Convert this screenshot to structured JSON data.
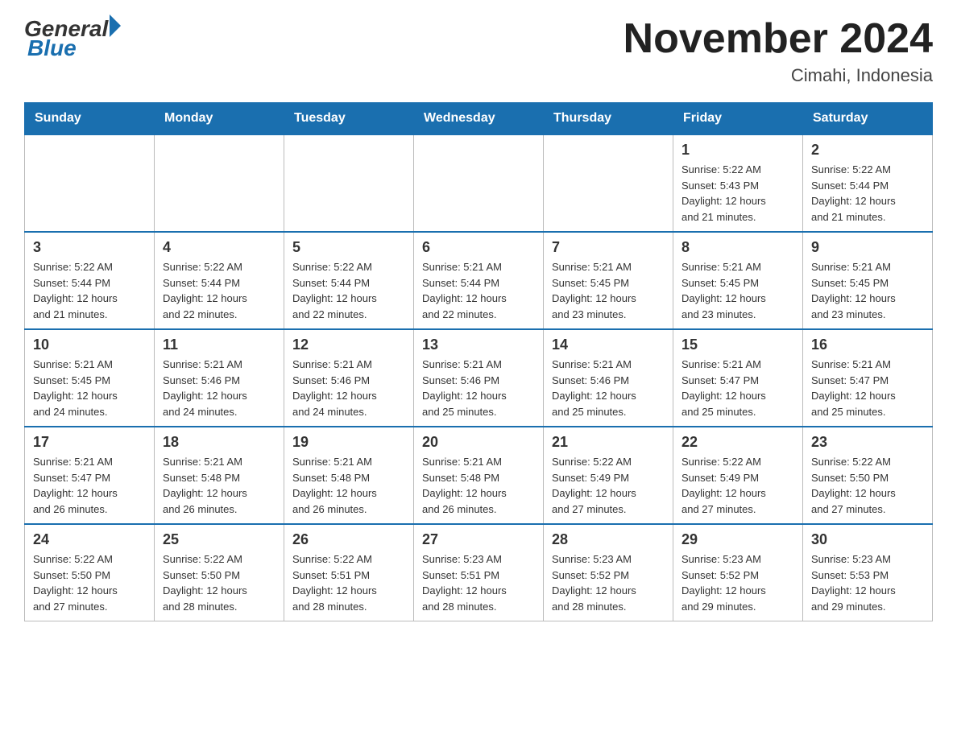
{
  "logo": {
    "text_general": "General",
    "text_blue": "Blue"
  },
  "header": {
    "month_year": "November 2024",
    "location": "Cimahi, Indonesia"
  },
  "weekdays": [
    "Sunday",
    "Monday",
    "Tuesday",
    "Wednesday",
    "Thursday",
    "Friday",
    "Saturday"
  ],
  "weeks": [
    [
      {
        "day": "",
        "info": ""
      },
      {
        "day": "",
        "info": ""
      },
      {
        "day": "",
        "info": ""
      },
      {
        "day": "",
        "info": ""
      },
      {
        "day": "",
        "info": ""
      },
      {
        "day": "1",
        "info": "Sunrise: 5:22 AM\nSunset: 5:43 PM\nDaylight: 12 hours\nand 21 minutes."
      },
      {
        "day": "2",
        "info": "Sunrise: 5:22 AM\nSunset: 5:44 PM\nDaylight: 12 hours\nand 21 minutes."
      }
    ],
    [
      {
        "day": "3",
        "info": "Sunrise: 5:22 AM\nSunset: 5:44 PM\nDaylight: 12 hours\nand 21 minutes."
      },
      {
        "day": "4",
        "info": "Sunrise: 5:22 AM\nSunset: 5:44 PM\nDaylight: 12 hours\nand 22 minutes."
      },
      {
        "day": "5",
        "info": "Sunrise: 5:22 AM\nSunset: 5:44 PM\nDaylight: 12 hours\nand 22 minutes."
      },
      {
        "day": "6",
        "info": "Sunrise: 5:21 AM\nSunset: 5:44 PM\nDaylight: 12 hours\nand 22 minutes."
      },
      {
        "day": "7",
        "info": "Sunrise: 5:21 AM\nSunset: 5:45 PM\nDaylight: 12 hours\nand 23 minutes."
      },
      {
        "day": "8",
        "info": "Sunrise: 5:21 AM\nSunset: 5:45 PM\nDaylight: 12 hours\nand 23 minutes."
      },
      {
        "day": "9",
        "info": "Sunrise: 5:21 AM\nSunset: 5:45 PM\nDaylight: 12 hours\nand 23 minutes."
      }
    ],
    [
      {
        "day": "10",
        "info": "Sunrise: 5:21 AM\nSunset: 5:45 PM\nDaylight: 12 hours\nand 24 minutes."
      },
      {
        "day": "11",
        "info": "Sunrise: 5:21 AM\nSunset: 5:46 PM\nDaylight: 12 hours\nand 24 minutes."
      },
      {
        "day": "12",
        "info": "Sunrise: 5:21 AM\nSunset: 5:46 PM\nDaylight: 12 hours\nand 24 minutes."
      },
      {
        "day": "13",
        "info": "Sunrise: 5:21 AM\nSunset: 5:46 PM\nDaylight: 12 hours\nand 25 minutes."
      },
      {
        "day": "14",
        "info": "Sunrise: 5:21 AM\nSunset: 5:46 PM\nDaylight: 12 hours\nand 25 minutes."
      },
      {
        "day": "15",
        "info": "Sunrise: 5:21 AM\nSunset: 5:47 PM\nDaylight: 12 hours\nand 25 minutes."
      },
      {
        "day": "16",
        "info": "Sunrise: 5:21 AM\nSunset: 5:47 PM\nDaylight: 12 hours\nand 25 minutes."
      }
    ],
    [
      {
        "day": "17",
        "info": "Sunrise: 5:21 AM\nSunset: 5:47 PM\nDaylight: 12 hours\nand 26 minutes."
      },
      {
        "day": "18",
        "info": "Sunrise: 5:21 AM\nSunset: 5:48 PM\nDaylight: 12 hours\nand 26 minutes."
      },
      {
        "day": "19",
        "info": "Sunrise: 5:21 AM\nSunset: 5:48 PM\nDaylight: 12 hours\nand 26 minutes."
      },
      {
        "day": "20",
        "info": "Sunrise: 5:21 AM\nSunset: 5:48 PM\nDaylight: 12 hours\nand 26 minutes."
      },
      {
        "day": "21",
        "info": "Sunrise: 5:22 AM\nSunset: 5:49 PM\nDaylight: 12 hours\nand 27 minutes."
      },
      {
        "day": "22",
        "info": "Sunrise: 5:22 AM\nSunset: 5:49 PM\nDaylight: 12 hours\nand 27 minutes."
      },
      {
        "day": "23",
        "info": "Sunrise: 5:22 AM\nSunset: 5:50 PM\nDaylight: 12 hours\nand 27 minutes."
      }
    ],
    [
      {
        "day": "24",
        "info": "Sunrise: 5:22 AM\nSunset: 5:50 PM\nDaylight: 12 hours\nand 27 minutes."
      },
      {
        "day": "25",
        "info": "Sunrise: 5:22 AM\nSunset: 5:50 PM\nDaylight: 12 hours\nand 28 minutes."
      },
      {
        "day": "26",
        "info": "Sunrise: 5:22 AM\nSunset: 5:51 PM\nDaylight: 12 hours\nand 28 minutes."
      },
      {
        "day": "27",
        "info": "Sunrise: 5:23 AM\nSunset: 5:51 PM\nDaylight: 12 hours\nand 28 minutes."
      },
      {
        "day": "28",
        "info": "Sunrise: 5:23 AM\nSunset: 5:52 PM\nDaylight: 12 hours\nand 28 minutes."
      },
      {
        "day": "29",
        "info": "Sunrise: 5:23 AM\nSunset: 5:52 PM\nDaylight: 12 hours\nand 29 minutes."
      },
      {
        "day": "30",
        "info": "Sunrise: 5:23 AM\nSunset: 5:53 PM\nDaylight: 12 hours\nand 29 minutes."
      }
    ]
  ]
}
